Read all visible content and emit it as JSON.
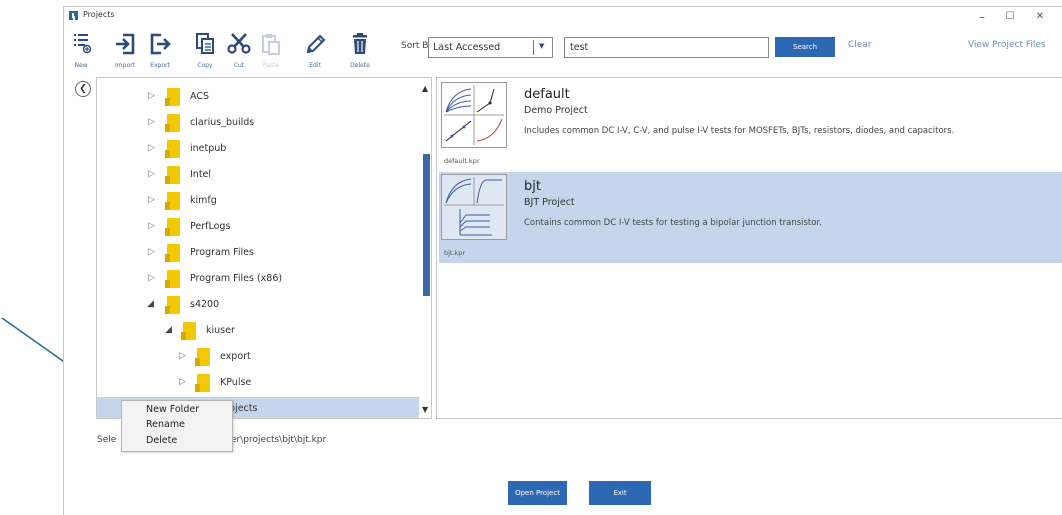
{
  "window": {
    "title": "Projects",
    "controls": {
      "minimize": "–",
      "maximize": "☐",
      "close": "✕"
    }
  },
  "toolbar": {
    "buttons": [
      {
        "id": "new",
        "label": "New",
        "icon": "new-list-icon",
        "enabled": true
      },
      {
        "id": "import",
        "label": "Import",
        "icon": "import-icon",
        "enabled": true
      },
      {
        "id": "export",
        "label": "Export",
        "icon": "export-icon",
        "enabled": true
      },
      {
        "id": "copy",
        "label": "Copy",
        "icon": "copy-icon",
        "enabled": true
      },
      {
        "id": "cut",
        "label": "Cut",
        "icon": "scissors-icon",
        "enabled": true
      },
      {
        "id": "paste",
        "label": "Paste",
        "icon": "paste-icon",
        "enabled": false
      },
      {
        "id": "edit",
        "label": "Edit",
        "icon": "pencil-icon",
        "enabled": true
      },
      {
        "id": "delete",
        "label": "Delete",
        "icon": "trash-icon",
        "enabled": true
      }
    ],
    "sort_by_label": "Sort By",
    "sort_value": "Last Accessed",
    "search_value": "test",
    "search_button": "Search",
    "clear_label": "Clear",
    "view_files_label": "View Project Files"
  },
  "tree": {
    "items": [
      {
        "label": "ACS",
        "level": 0,
        "expanded": false,
        "selected": false
      },
      {
        "label": "clarius_builds",
        "level": 0,
        "expanded": false,
        "selected": false
      },
      {
        "label": "inetpub",
        "level": 0,
        "expanded": false,
        "selected": false
      },
      {
        "label": "Intel",
        "level": 0,
        "expanded": false,
        "selected": false
      },
      {
        "label": "kimfg",
        "level": 0,
        "expanded": false,
        "selected": false
      },
      {
        "label": "PerfLogs",
        "level": 0,
        "expanded": false,
        "selected": false
      },
      {
        "label": "Program Files",
        "level": 0,
        "expanded": false,
        "selected": false
      },
      {
        "label": "Program Files (x86)",
        "level": 0,
        "expanded": false,
        "selected": false
      },
      {
        "label": "s4200",
        "level": 0,
        "expanded": true,
        "selected": false
      },
      {
        "label": "kiuser",
        "level": 1,
        "expanded": true,
        "selected": false
      },
      {
        "label": "export",
        "level": 2,
        "expanded": false,
        "selected": false
      },
      {
        "label": "KPulse",
        "level": 2,
        "expanded": false,
        "selected": false
      },
      {
        "label": "Projects",
        "level": 2,
        "expanded": false,
        "selected": true
      }
    ]
  },
  "projects": [
    {
      "name": "default",
      "type": "Demo Project",
      "description": "Includes common DC I-V, C-V, and pulse I-V tests for MOSFETs, BJTs, resistors, diodes, and capacitors.",
      "file": "default.kpr",
      "selected": false
    },
    {
      "name": "bjt",
      "type": "BJT Project",
      "description": "Contains common DC I-V tests for testing a bipolar junction transistor.",
      "file": "bjt.kpr",
      "selected": true
    }
  ],
  "status": {
    "prefix": "Sele",
    "path": "ser\\projects\\bjt\\bjt.kpr"
  },
  "buttons": {
    "open_project": "Open Project",
    "exit": "Exit"
  },
  "context_menu": {
    "items": [
      "New Folder",
      "Rename",
      "Delete"
    ]
  },
  "colors": {
    "accent": "#2c68b3",
    "selection": "#c5d6ec",
    "folder": "#f2c800",
    "annotation_arrow": "#2a6f8f"
  }
}
